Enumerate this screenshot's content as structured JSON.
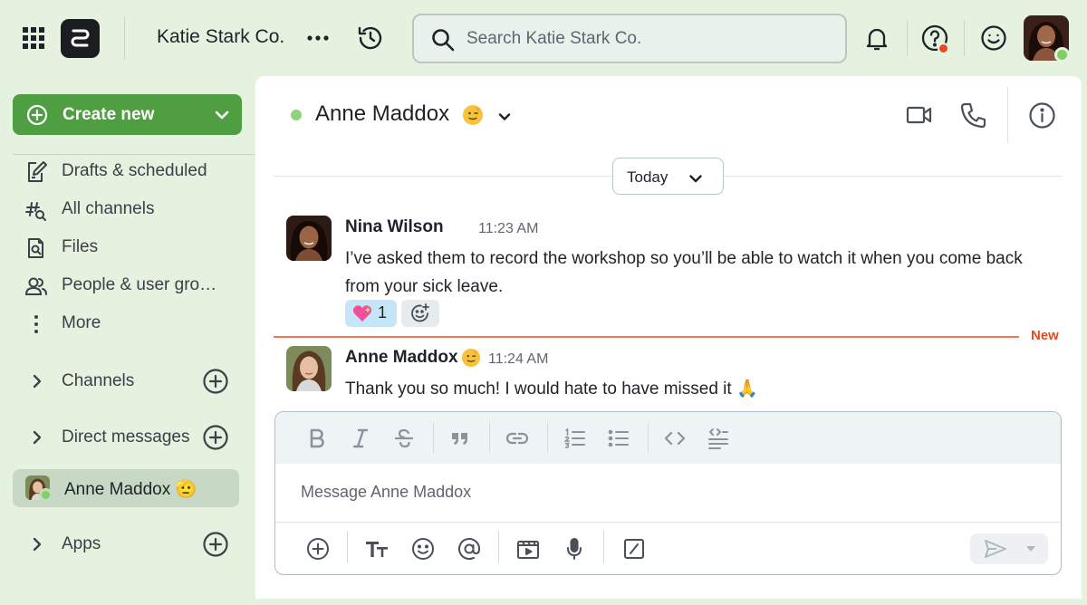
{
  "topbar": {
    "workspace_name": "Katie Stark Co.",
    "search_placeholder": "Search Katie Stark Co."
  },
  "sidebar": {
    "create_label": "Create new",
    "items": [
      {
        "label": "Drafts & scheduled",
        "icon": "drafts-icon"
      },
      {
        "label": "All channels",
        "icon": "hashtag-search-icon"
      },
      {
        "label": "Files",
        "icon": "file-search-icon"
      },
      {
        "label": "People & user gro…",
        "icon": "people-icon"
      },
      {
        "label": "More",
        "icon": "vertical-dots-icon"
      }
    ],
    "sections": [
      {
        "label": "Channels"
      },
      {
        "label": "Direct messages"
      }
    ],
    "active_dm": {
      "label": "Anne Maddox",
      "emoji": "🫡"
    },
    "apps_label": "Apps"
  },
  "conversation": {
    "title": "Anne Maddox",
    "date_label": "Today",
    "new_label": "New",
    "messages": [
      {
        "author": "Nina Wilson",
        "time": "11:23 AM",
        "text": "I’ve asked them to record the workshop so you’ll be able to watch it when you come back from your sick leave.",
        "reaction_emoji": "💖",
        "reaction_count": "1"
      },
      {
        "author": "Anne Maddox",
        "time": "11:24 AM",
        "text": "Thank you so much! I would hate to have missed it 🙏"
      }
    ]
  },
  "composer": {
    "placeholder": "Message Anne Maddox",
    "format_buttons": [
      "bold-icon",
      "italic-icon",
      "strikethrough-icon",
      "quote-icon",
      "link-icon",
      "ordered-list-icon",
      "bullet-list-icon",
      "code-icon",
      "code-block-icon"
    ],
    "action_buttons": [
      "add-icon",
      "text-format-icon",
      "emoji-icon",
      "mention-icon",
      "video-clip-icon",
      "microphone-icon",
      "slash-command-icon"
    ]
  },
  "colors": {
    "accent_green": "#4f9e42",
    "page_background": "#e6f2e0",
    "online_status": "#7bd262",
    "new_marker": "#e8491d",
    "reaction_bg": "#c4e6f7"
  }
}
